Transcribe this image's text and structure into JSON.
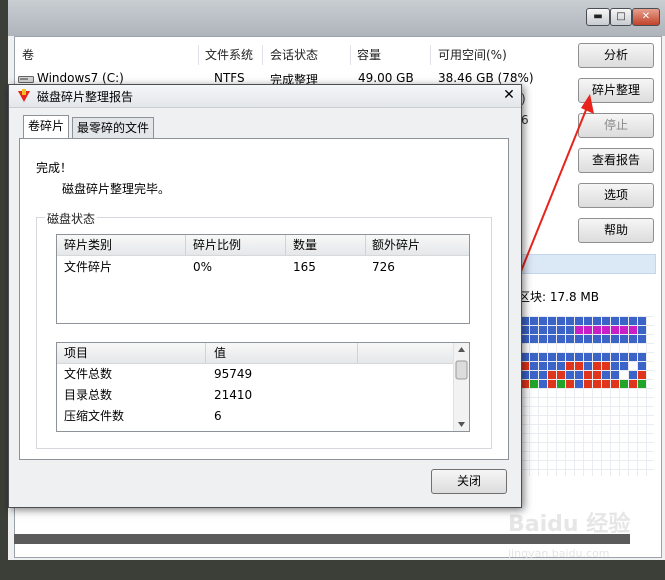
{
  "bg": {
    "caption_buttons": [
      "▬",
      "□",
      "✕"
    ],
    "columns": [
      "卷",
      "文件系统",
      "会话状态",
      "容量",
      "可用空间(%)"
    ],
    "volume_row": {
      "name": "Windows7 (C:)",
      "fs": "NTFS",
      "status": "完成整理",
      "capacity": "49.00 GB",
      "free": "38.46 GB (78%)"
    },
    "clipped_right_chars": [
      ")",
      "6",
      "6"
    ],
    "side_buttons": [
      "分析",
      "碎片整理",
      "停止",
      "查看报告",
      "选项",
      "帮助"
    ],
    "block_legend": "区块: 17.8 MB",
    "colors": {
      "blue": "#3c64c8",
      "red": "#e0341c",
      "green": "#22a32a",
      "magenta": "#c81fc8",
      "white": "#ffffff"
    },
    "watermark": "Baidu 经验",
    "watermark_url": "jingyan.baidu.com"
  },
  "dialog": {
    "title": "磁盘碎片整理报告",
    "close_glyph": "✕",
    "tabs": [
      "卷碎片",
      "最零碎的文件"
    ],
    "done_label": "完成！",
    "done_message": "磁盘碎片整理完毕。",
    "group_label": "磁盘状态",
    "frag_table": {
      "headers": [
        "碎片类别",
        "碎片比例",
        "数量",
        "额外碎片"
      ],
      "row": [
        "文件碎片",
        "0%",
        "165",
        "726"
      ]
    },
    "stats_table": {
      "headers": [
        "项目",
        "值"
      ],
      "rows": [
        [
          "文件总数",
          "95749"
        ],
        [
          "目录总数",
          "21410"
        ],
        [
          "压缩文件数",
          "6"
        ]
      ]
    },
    "close_button": "关闭"
  }
}
